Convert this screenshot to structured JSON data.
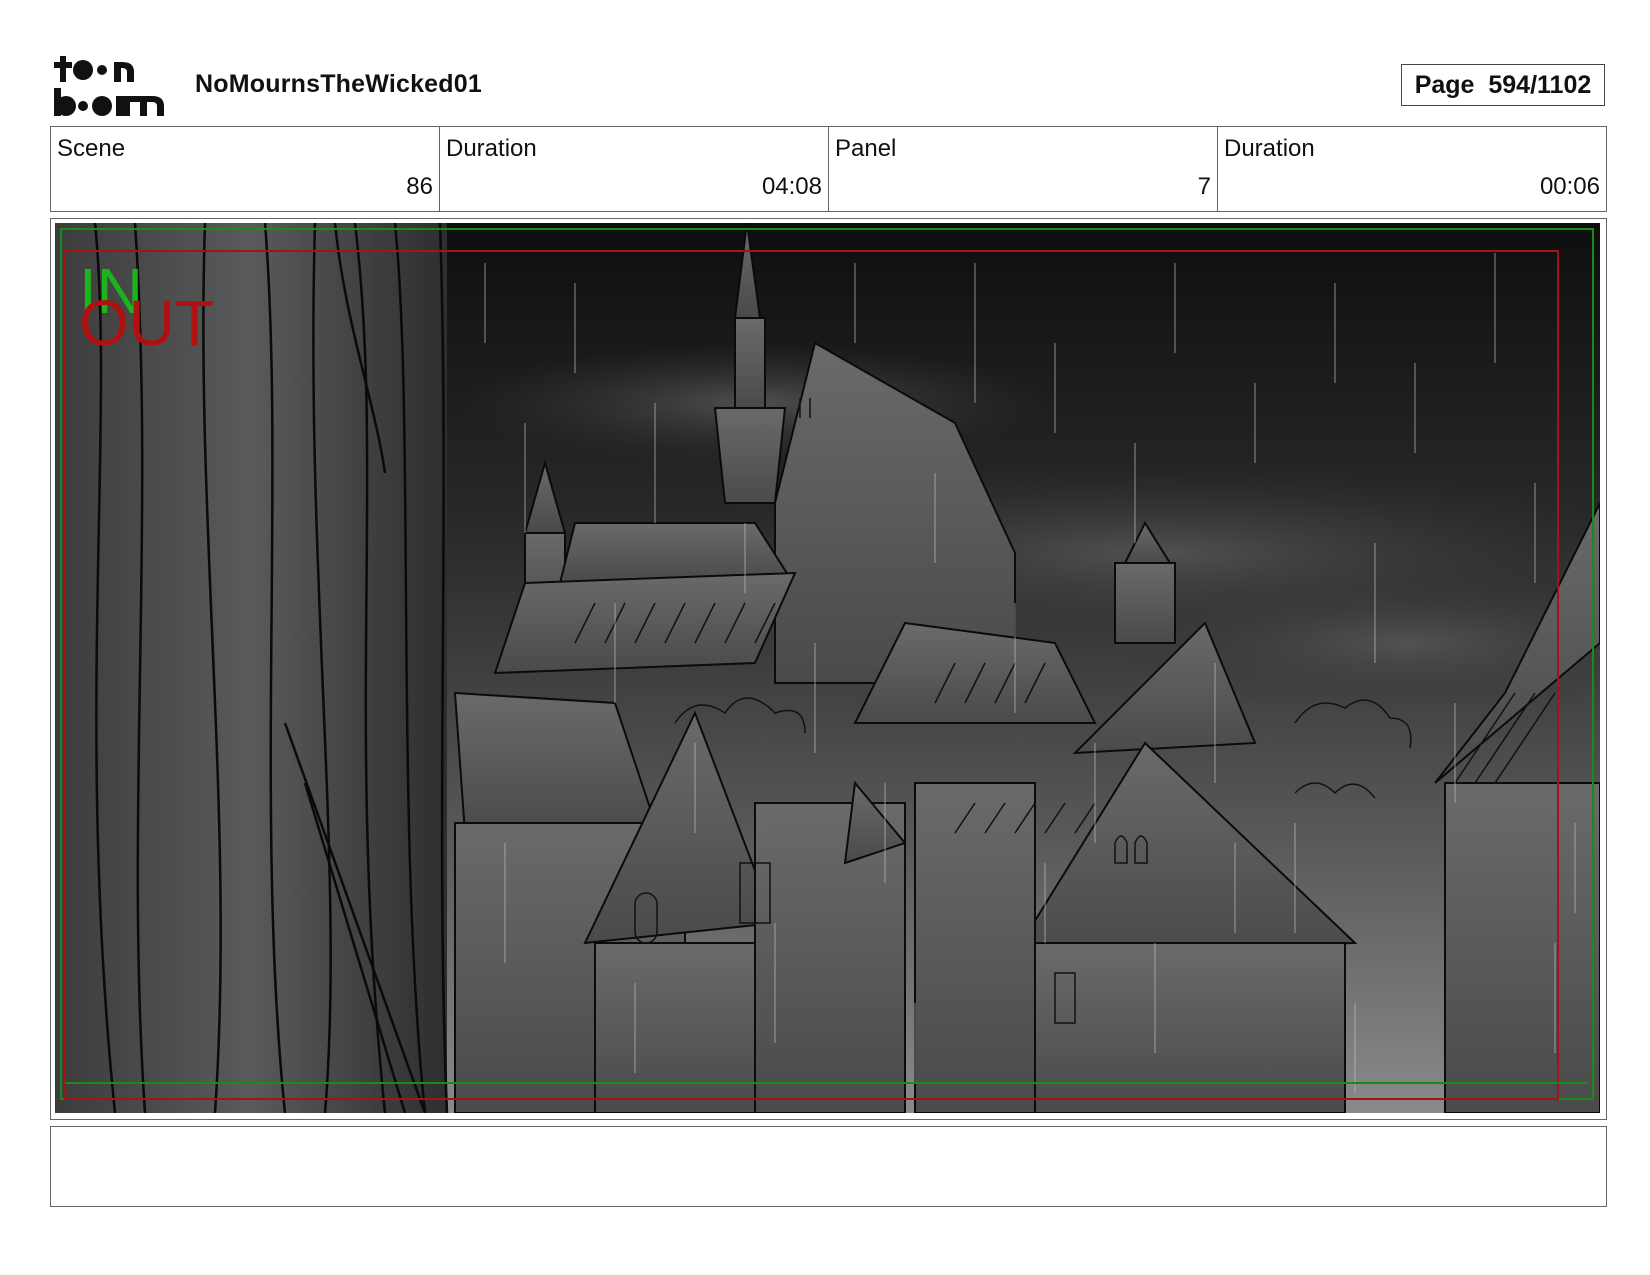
{
  "header": {
    "project_title": "NoMournsTheWicked01",
    "page_label": "Page",
    "page_number": "594/1102"
  },
  "info": [
    {
      "label": "Scene",
      "value": "86"
    },
    {
      "label": "Duration",
      "value": "04:08"
    },
    {
      "label": "Panel",
      "value": "7"
    },
    {
      "label": "Duration",
      "value": "00:06"
    }
  ],
  "panel": {
    "in_marker": "IN",
    "out_marker": "OUT",
    "in_color": "#1db31d",
    "out_color": "#b01010"
  },
  "notes": {
    "text": ""
  }
}
